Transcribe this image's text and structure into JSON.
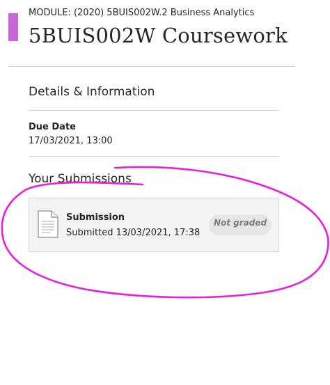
{
  "header": {
    "module_label": "MODULE: (2020) 5BUIS002W.2 Business Analytics",
    "title": "5BUIS002W Coursework"
  },
  "details": {
    "heading": "Details & Information",
    "due_label": "Due Date",
    "due_value": "17/03/2021, 13:00"
  },
  "submissions": {
    "heading": "Your Submissions",
    "card": {
      "icon": "document-icon",
      "title": "Submission",
      "submitted_text": "Submitted 13/03/2021, 17:38",
      "grade_status": "Not graded"
    }
  },
  "colors": {
    "side_tab": "#c568d6",
    "annotation_marker": "#e81ee0",
    "card_background": "#f3f3f3"
  }
}
